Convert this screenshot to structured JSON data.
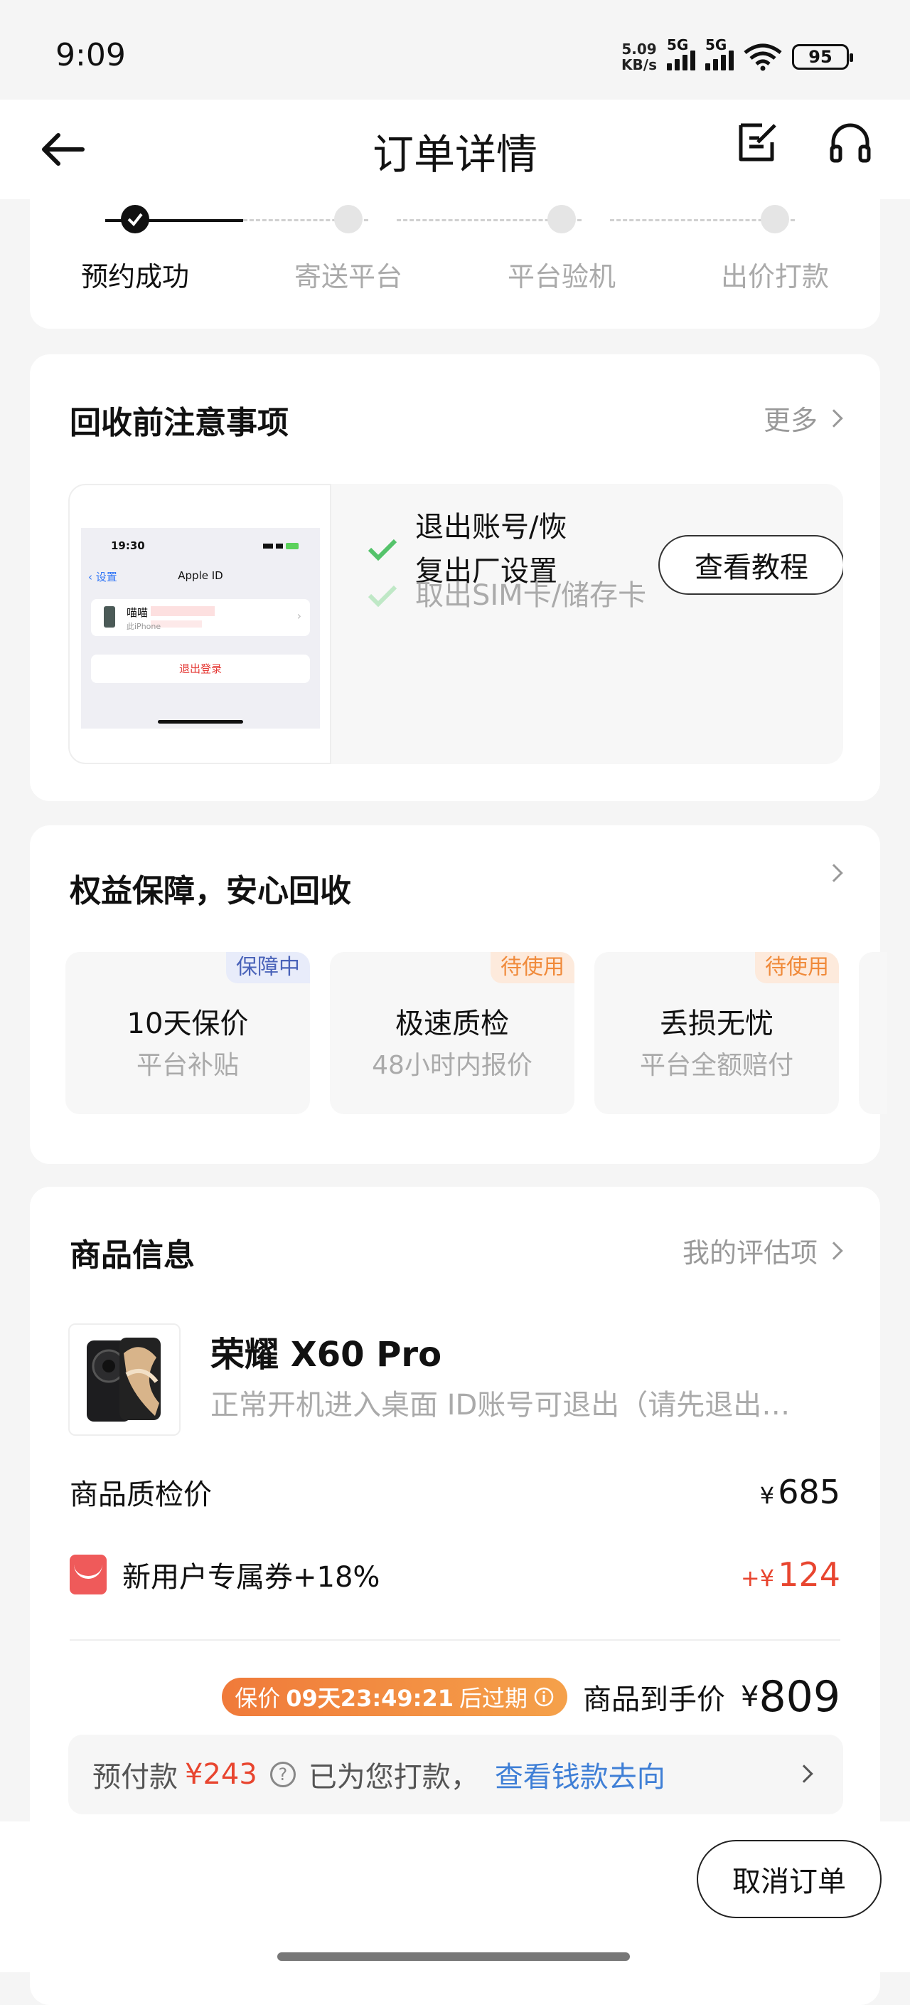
{
  "status_bar": {
    "time": "9:09",
    "net_speed_value": "5.09",
    "net_speed_unit": "KB/s",
    "sim1_label": "5G",
    "sim2_label": "5G",
    "battery": "95"
  },
  "nav": {
    "title": "订单详情"
  },
  "progress": {
    "steps": [
      "预约成功",
      "寄送平台",
      "平台验机",
      "出价打款"
    ],
    "current_step": 1
  },
  "notice": {
    "title": "回收前注意事项",
    "more": "更多",
    "item1": "退出账号/恢复出厂设置",
    "item1_line1": "退出账号/恢",
    "item1_line2": "复出厂设置",
    "item2": "取出SIM卡/储存卡",
    "tutorial_button": "查看教程",
    "preview": {
      "time": "19:30",
      "back": "设置",
      "title": "Apple ID",
      "name": "喵喵",
      "sub": "此iPhone",
      "logout": "退出登录"
    }
  },
  "rights": {
    "title": "权益保障，安心回收",
    "tiles": [
      {
        "badge": "保障中",
        "title": "10天保价",
        "subtitle": "平台补贴",
        "badge_color": "#4a63b9"
      },
      {
        "badge": "待使用",
        "title": "极速质检",
        "subtitle": "48小时内报价",
        "badge_color": "#f08a3a"
      },
      {
        "badge": "待使用",
        "title": "丢损无忧",
        "subtitle": "平台全额赔付",
        "badge_color": "#f08a3a"
      }
    ]
  },
  "goods": {
    "title": "商品信息",
    "my_assessment": "我的评估项",
    "product_name": "荣耀 X60 Pro",
    "product_desc": "正常开机进入桌面 ID账号可退出（请先退出…",
    "inspect_label": "商品质检价",
    "inspect_currency": "¥",
    "inspect_price": "685",
    "coupon_label": "新用户专属券+18%",
    "coupon_prefix": "+",
    "coupon_currency": "¥",
    "coupon_amount": "124",
    "countdown_prefix": "保价",
    "countdown_time": "09天23:49:21",
    "countdown_suffix": "后过期",
    "final_label": "商品到手价",
    "final_currency": "¥",
    "final_price": "809",
    "prepay_label": "预付款",
    "prepay_currency": "¥",
    "prepay_amount": "243",
    "prepay_status": "已为您打款，",
    "prepay_link": "查看钱款去向"
  },
  "footer": {
    "cancel_button": "取消订单"
  },
  "colors": {
    "accent_red": "#e8452f",
    "link_blue": "#3f7fd6",
    "check_green": "#55c36b",
    "countdown_orange": "#f07a3a"
  }
}
